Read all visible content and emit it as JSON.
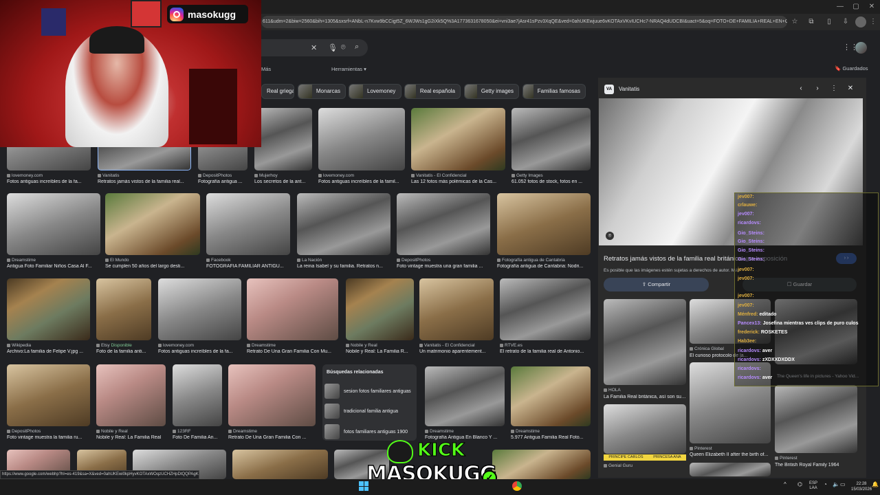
{
  "browser": {
    "url": "611&udm=2&biw=2560&bih=1305&sxsrf=ANbL-n7Kvw9bCCigt5Z_6WJWs1gG2iXk5Q%3A1773631678050&ei=vni3ae7jAsr41sPzv3XqQE&ved=0ahUKEwjuue6vKOTAxVKvIUCHc7-NRAQ4dUDCBI&uact=5&oq=FOTO+DE+FAMILIA+REAL+EN+C...",
    "status_url": "https://www.google.com/webhp?hl=es-419&sa=X&ved=0ahUKEwi0kpHyvKOTAxWOqzUCHZHpDtQQPAgK"
  },
  "search": {
    "tabs": {
      "more": "Más",
      "tools": "Herramientas"
    },
    "saved": "Guardados"
  },
  "chips": [
    {
      "label": "Real griega"
    },
    {
      "label": "Monarcas"
    },
    {
      "label": "Lovemoney"
    },
    {
      "label": "Real española"
    },
    {
      "label": "Getty images"
    },
    {
      "label": "Familias famosas"
    }
  ],
  "results": {
    "row1": [
      {
        "source": "lovemoney.com",
        "title": "Fotos antiguas increíbles de la fa..."
      },
      {
        "source": "Vanitatis",
        "title": "Retratos jamás vistos de la familia real..."
      },
      {
        "source": "DepositPhotos",
        "title": "Fotografía antigua ..."
      },
      {
        "source": "Mujerhoy",
        "title": "Los secretos de la ant..."
      },
      {
        "source": "lovemoney.com",
        "title": "Fotos antiguas increíbles de la famil..."
      },
      {
        "source": "Vanitatis - El Confidencial",
        "title": "Las 12 fotos más polémicas de la Cas..."
      },
      {
        "source": "Getty Images",
        "title": "61.052 fotos de stock, fotos en ..."
      }
    ],
    "row2": [
      {
        "source": "Dreamstime",
        "title": "Antigua Foto Familiar Niños Casa Al F..."
      },
      {
        "source": "El Mundo",
        "title": "Se cumplen 50 años del largo desti..."
      },
      {
        "source": "Facebook",
        "title": "FOTOGRAFIA FAMILIAR ANTIGU..."
      },
      {
        "source": "La Nación",
        "title": "La reina Isabel y su familia. Retratos n..."
      },
      {
        "source": "DepositPhotos",
        "title": "Foto vintage muestra una gran familia ..."
      },
      {
        "source": "Fotografía antigua de Cantabria",
        "title": "Fotografía antigua de Cantabria: Nodri..."
      }
    ],
    "row3": [
      {
        "source": "Wikipedia",
        "title": "Archivo:La familia de Felipe V.jpg ..."
      },
      {
        "source": "Etsy",
        "available": "Disponible",
        "title": "Foto de la familia anti..."
      },
      {
        "source": "lovemoney.com",
        "title": "Fotos antiguas increíbles de la fa..."
      },
      {
        "source": "Dreamstime",
        "title": "Retrato De Una Gran Familia Con Mu..."
      },
      {
        "source": "Nobile y Real",
        "title": "Nobile y Real: La Familia R..."
      },
      {
        "source": "Vanitatis - El Confidencial",
        "title": "Un matrimonio aparentement..."
      },
      {
        "source": "RTVE.es",
        "title": "El retrato de la familia real de Antonio..."
      }
    ],
    "row4": [
      {
        "source": "DepositPhotos",
        "title": "Foto vintage muestra la familia ru..."
      },
      {
        "source": "Nobile y Real",
        "title": "Nobile y Real: La Familia Real"
      },
      {
        "source": "123RF",
        "title": "Foto De Familia An..."
      },
      {
        "source": "Dreamstime",
        "title": "Retrato De Una Gran Familia Con ..."
      },
      {
        "source": "Dreamstime",
        "title": "Fotografía Antigua En Blanco Y ..."
      },
      {
        "source": "Dreamstime",
        "title": "5.977 Antigua Familia Real Foto..."
      }
    ]
  },
  "related": {
    "heading": "Búsquedas relacionadas",
    "items": [
      {
        "label": "sesion fotos familiares antiguas"
      },
      {
        "label": "tradicional familia antigua"
      },
      {
        "label": "fotos familiares antiguas 1900"
      }
    ]
  },
  "panel": {
    "source": "Vanitatis",
    "title": "Retratos jamás vistos de la familia real británica",
    "title_tail": "una exposición",
    "note": "Es posible que las imágenes estén sujetas a derechos de autor.",
    "note_more": "Más",
    "share": "Compartir",
    "save": "Guardar",
    "cards": [
      {
        "source": "HOLA",
        "title": "La Familia Real británica, así son sus..."
      },
      {
        "source": "Crónica Global",
        "title": "El curioso protocolo de la..."
      },
      {
        "caption": "The Queen's life in pictures - Yahoo Vid..."
      },
      {
        "source": "Pinterest",
        "title": "Queen Elizabeth II after the birth of..."
      },
      {
        "source": "Pinterest",
        "title": "The British Royal Family 1964"
      },
      {
        "source": "Genial Guru",
        "banner_left": "PRINCIPE CARLOS",
        "banner_right": "PRINCESA ANA"
      }
    ]
  },
  "stream": {
    "instagram": "masokugg",
    "kick_top": "KICK",
    "kick_name": "MASOKUGG",
    "chat": [
      {
        "user": "jev007:",
        "msg": ""
      },
      {
        "user": "crlauwe:",
        "msg": ""
      },
      {
        "user": "jev007:",
        "msg": ""
      },
      {
        "user": "ricardovs:",
        "msg": ""
      },
      {
        "user": "Gio_Steins:",
        "msg": ""
      },
      {
        "user": "Gio_Steins:",
        "msg": ""
      },
      {
        "user": "Gio_Steins:",
        "msg": ""
      },
      {
        "user": "Gio_Steins:",
        "msg": ""
      },
      {
        "user": "jev007:",
        "msg": ""
      },
      {
        "user": "jev007:",
        "msg": ""
      },
      {
        "user": "jev007:",
        "msg": ""
      },
      {
        "user": "jev007:",
        "msg": ""
      },
      {
        "user": "Ménfred:",
        "msg": "editado"
      },
      {
        "user": "Pancex13:",
        "msg": "Josefina mientras ves clips de puro culos"
      },
      {
        "user": "frederick:",
        "msg": "ROSKETES"
      },
      {
        "user": "Hab3ee:",
        "msg": ""
      },
      {
        "user": "ricardovs:",
        "msg": "aver"
      },
      {
        "user": "ricardovs:",
        "msg": "zXDXXDXDDX"
      },
      {
        "user": "ricardovs:",
        "msg": ""
      },
      {
        "user": "ricardovs:",
        "msg": "aver"
      }
    ]
  },
  "taskbar": {
    "lang": "ESP",
    "layout": "LAA",
    "time": "22:28",
    "date": "15/03/2026"
  }
}
